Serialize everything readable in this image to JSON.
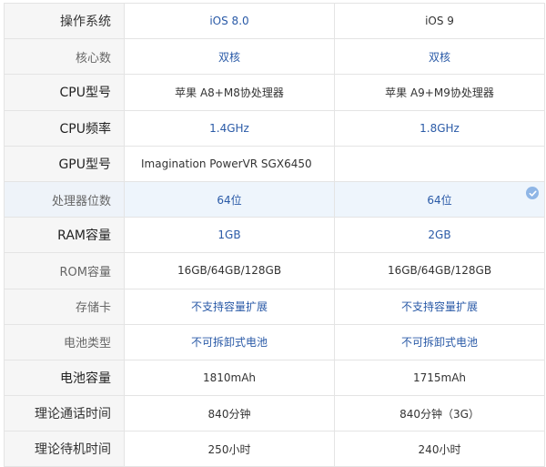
{
  "rows": [
    {
      "label": "操作系统",
      "a": "iOS 8.0",
      "b": "iOS 9"
    },
    {
      "label": "核心数",
      "a": "双核",
      "b": "双核"
    },
    {
      "label": "CPU型号",
      "a": "苹果 A8+M8协处理器",
      "b": "苹果 A9+M9协处理器"
    },
    {
      "label": "CPU频率",
      "a": "1.4GHz",
      "b": "1.8GHz"
    },
    {
      "label": "GPU型号",
      "a": "Imagination PowerVR SGX6450",
      "b": ""
    },
    {
      "label": "处理器位数",
      "a": "64位",
      "b": "64位"
    },
    {
      "label": "RAM容量",
      "a": "1GB",
      "b": "2GB"
    },
    {
      "label": "ROM容量",
      "a": "16GB/64GB/128GB",
      "b": "16GB/64GB/128GB"
    },
    {
      "label": "存储卡",
      "a": "不支持容量扩展",
      "b": "不支持容量扩展"
    },
    {
      "label": "电池类型",
      "a": "不可拆卸式电池",
      "b": "不可拆卸式电池"
    },
    {
      "label": "电池容量",
      "a": "1810mAh",
      "b": "1715mAh"
    },
    {
      "label": "理论通话时间",
      "a": "840分钟",
      "b": "840分钟（3G）"
    },
    {
      "label": "理论待机时间",
      "a": "250小时",
      "b": "240小时"
    }
  ],
  "colors": {
    "value_blue": "#2a5aa7",
    "label_bg": "#f6f6f6",
    "highlight_bg": "#eef5fc",
    "border": "#e4e4e4",
    "check_icon": "#8fb6e6"
  },
  "icons": {
    "highlight_check": "check-circle-icon"
  }
}
